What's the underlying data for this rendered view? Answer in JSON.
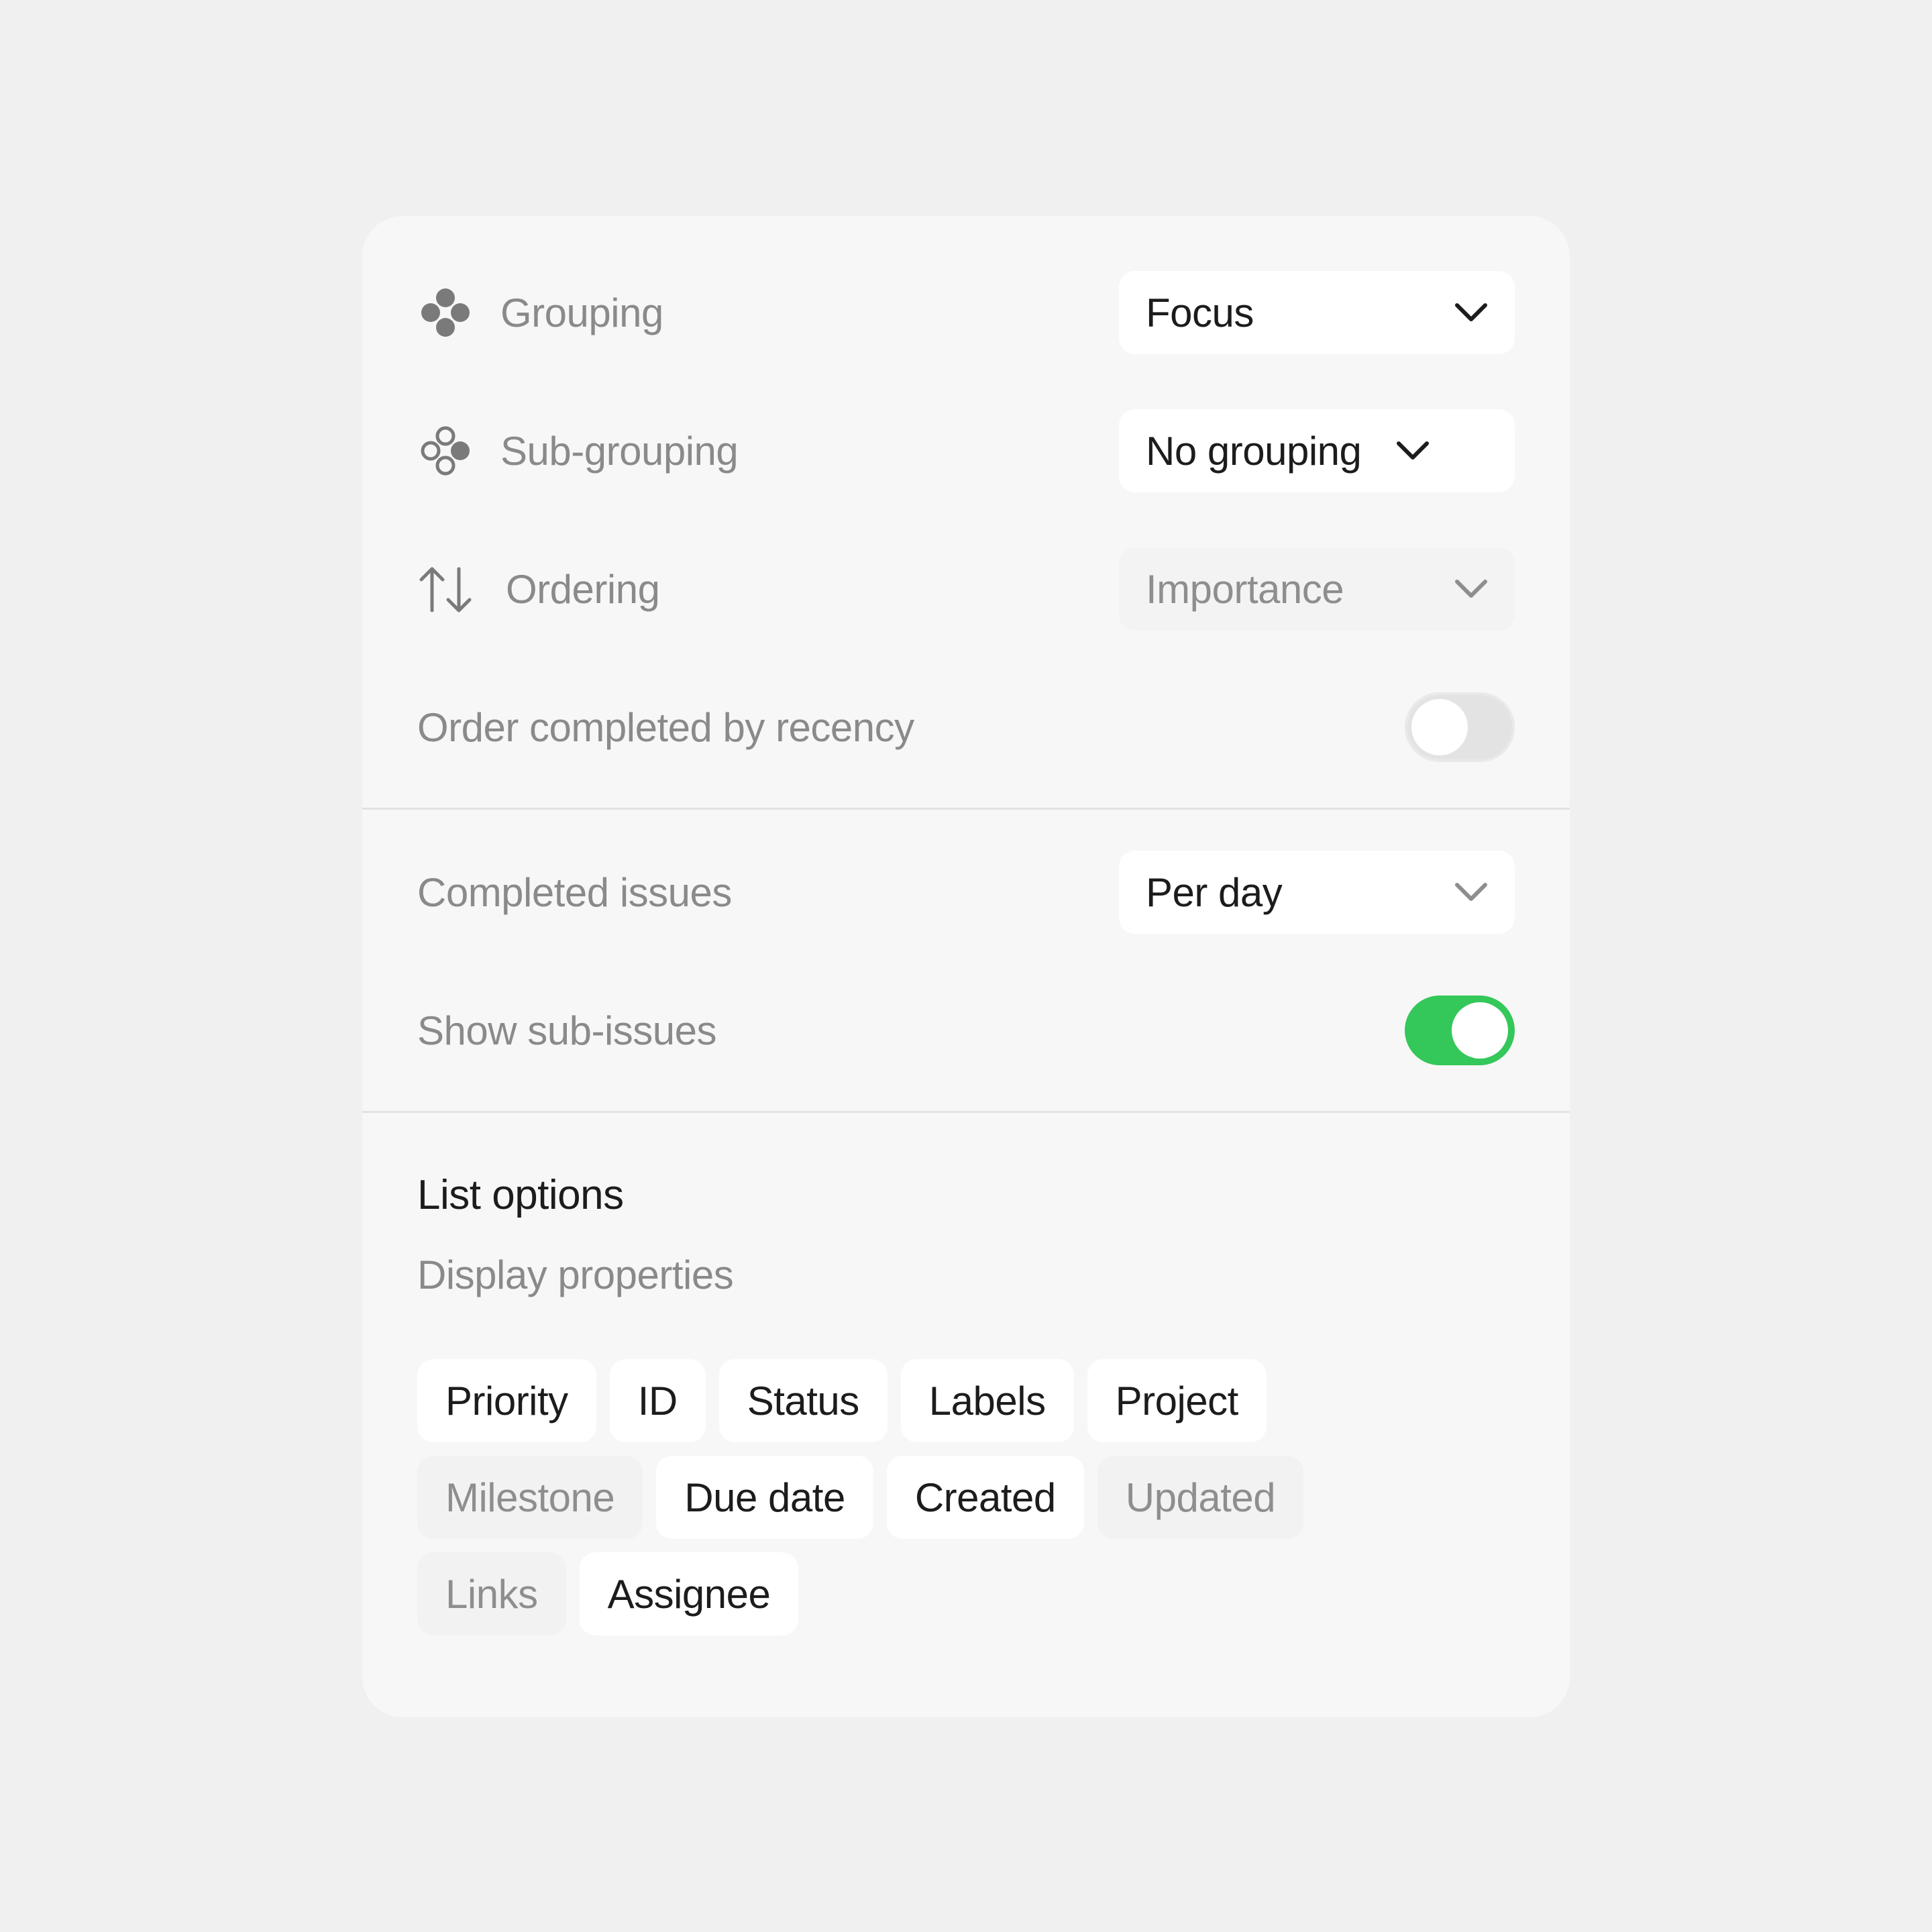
{
  "rows": {
    "grouping": {
      "label": "Grouping",
      "icon": "grouping-icon",
      "value": "Focus"
    },
    "subgrouping": {
      "label": "Sub-grouping",
      "icon": "sub-grouping-icon",
      "value": "No grouping"
    },
    "ordering": {
      "label": "Ordering",
      "icon": "sort-arrows-icon",
      "value": "Importance"
    },
    "order_completed": {
      "label": "Order completed by recency",
      "toggle": "off"
    },
    "completed_issues": {
      "label": "Completed issues",
      "value": "Per day"
    },
    "show_subissues": {
      "label": "Show sub-issues",
      "toggle": "on"
    }
  },
  "list_options": {
    "title": "List options",
    "subtitle": "Display properties",
    "chips": [
      {
        "label": "Priority",
        "active": true
      },
      {
        "label": "ID",
        "active": true
      },
      {
        "label": "Status",
        "active": true
      },
      {
        "label": "Labels",
        "active": true
      },
      {
        "label": "Project",
        "active": true
      },
      {
        "label": "Milestone",
        "active": false
      },
      {
        "label": "Due date",
        "active": true
      },
      {
        "label": "Created",
        "active": true
      },
      {
        "label": "Updated",
        "active": false
      },
      {
        "label": "Links",
        "active": false
      },
      {
        "label": "Assignee",
        "active": true
      }
    ]
  },
  "colors": {
    "toggle_on": "#34c759",
    "toggle_off": "#e3e3e3",
    "panel_bg": "#f7f7f7",
    "page_bg": "#f0f0f0"
  }
}
